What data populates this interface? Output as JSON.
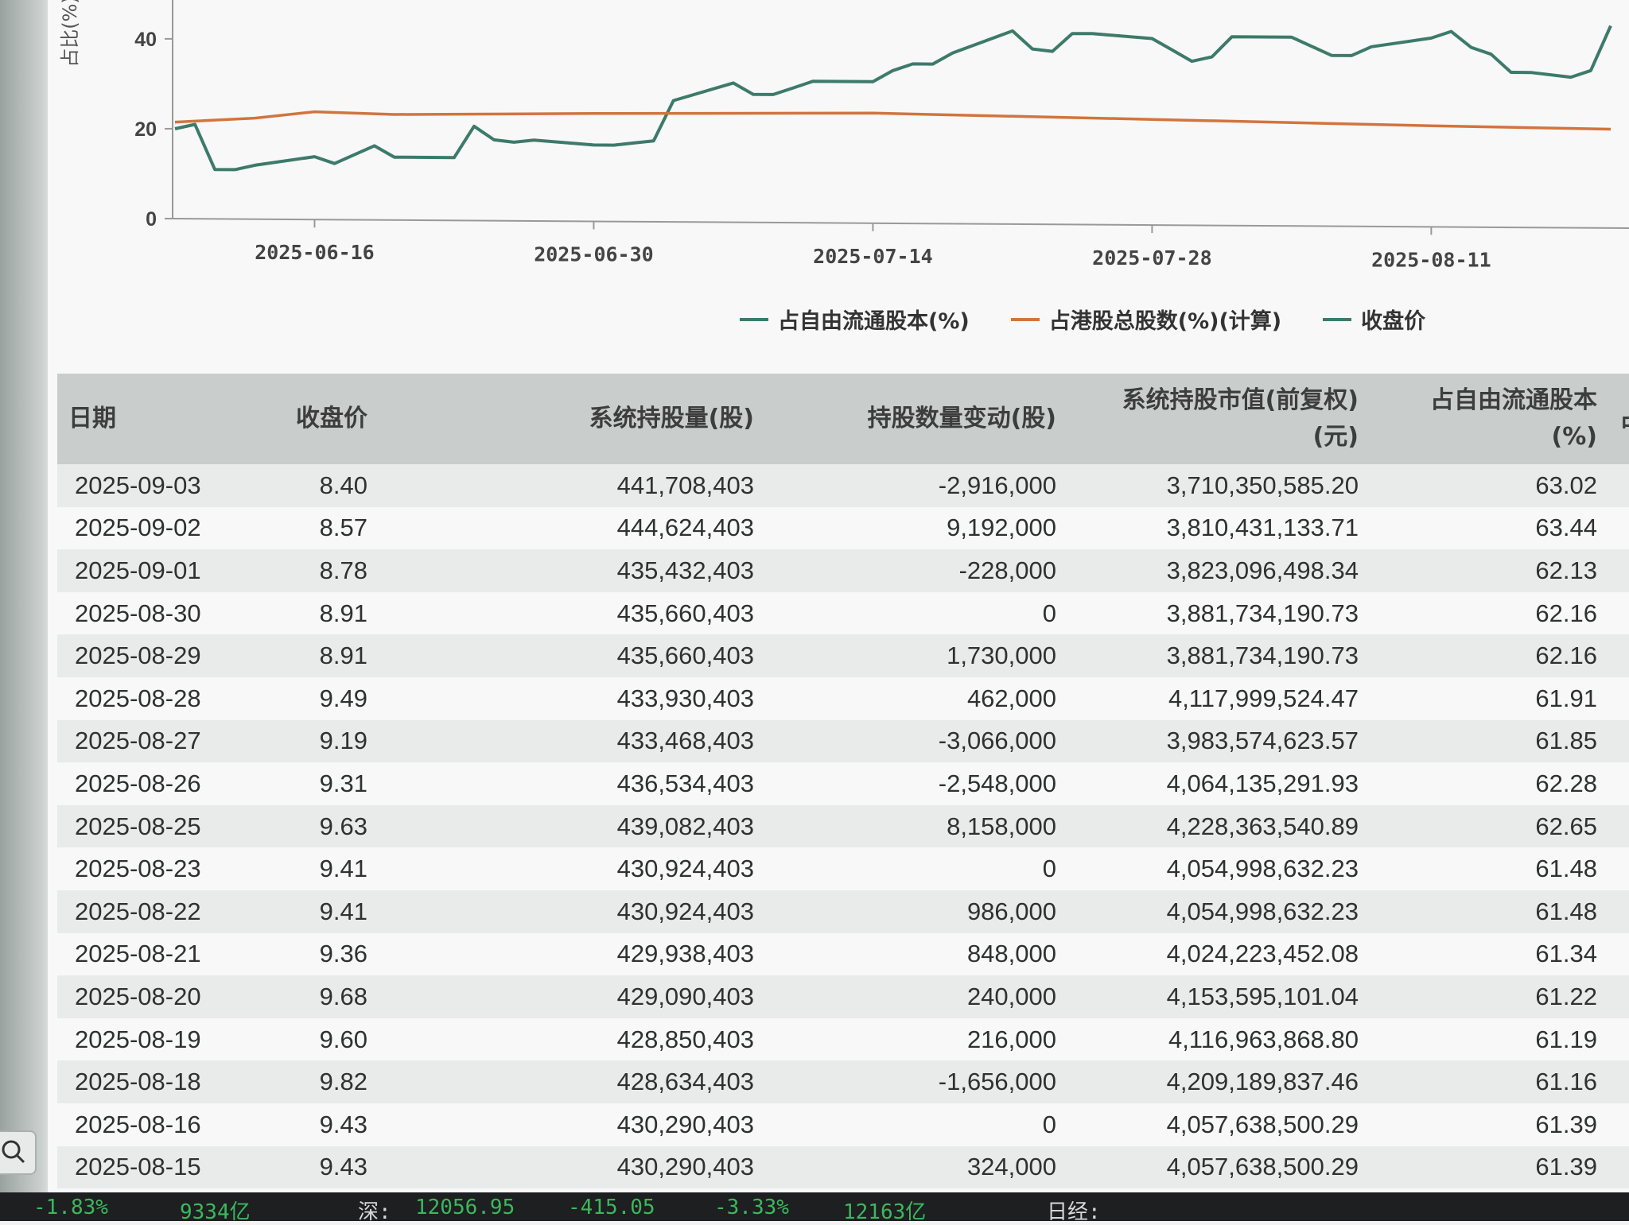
{
  "chart": {
    "y_axis_title": "占比(%)",
    "y_ticks": [
      "0",
      "20",
      "40"
    ],
    "x_ticks": [
      "2025-06-16",
      "2025-06-30",
      "2025-07-14",
      "2025-07-28",
      "2025-08-11"
    ],
    "legend": [
      {
        "label": "占自由流通股本(%)",
        "color": "#3d7a6a"
      },
      {
        "label": "占港股总股数(%)(计算)",
        "color": "#d2743e"
      },
      {
        "label": "收盘价",
        "color": "#3d7a6a"
      }
    ]
  },
  "chart_data": {
    "type": "line",
    "xlabel": "",
    "ylabel": "占比(%)",
    "ylim": [
      0,
      45
    ],
    "x_range": [
      "2025-06-09",
      "2025-08-19"
    ],
    "grid": false,
    "legend_position": "bottom",
    "series": [
      {
        "name": "占自由流通股本(%)",
        "color": "#3d7a6a",
        "points": [
          [
            "2025-06-09",
            20.0
          ],
          [
            "2025-06-10",
            21.0
          ],
          [
            "2025-06-11",
            11.0
          ],
          [
            "2025-06-12",
            11.0
          ],
          [
            "2025-06-13",
            12.0
          ],
          [
            "2025-06-16",
            14.0
          ],
          [
            "2025-06-17",
            12.5
          ],
          [
            "2025-06-18",
            14.5
          ],
          [
            "2025-06-19",
            16.5
          ],
          [
            "2025-06-20",
            14.0
          ],
          [
            "2025-06-23",
            14.0
          ],
          [
            "2025-06-24",
            21.0
          ],
          [
            "2025-06-25",
            18.0
          ],
          [
            "2025-06-26",
            17.5
          ],
          [
            "2025-06-27",
            18.0
          ],
          [
            "2025-06-30",
            17.0
          ],
          [
            "2025-07-01",
            17.0
          ],
          [
            "2025-07-02",
            17.5
          ],
          [
            "2025-07-03",
            18.0
          ],
          [
            "2025-07-04",
            27.0
          ],
          [
            "2025-07-07",
            31.0
          ],
          [
            "2025-07-08",
            28.5
          ],
          [
            "2025-07-09",
            28.5
          ],
          [
            "2025-07-10",
            30.0
          ],
          [
            "2025-07-11",
            31.5
          ],
          [
            "2025-07-14",
            31.5
          ],
          [
            "2025-07-15",
            34.0
          ],
          [
            "2025-07-16",
            35.5
          ],
          [
            "2025-07-17",
            35.5
          ],
          [
            "2025-07-18",
            38.0
          ],
          [
            "2025-07-21",
            43.0
          ],
          [
            "2025-07-22",
            39.0
          ],
          [
            "2025-07-23",
            38.5
          ],
          [
            "2025-07-24",
            42.5
          ],
          [
            "2025-07-25",
            42.5
          ],
          [
            "2025-07-28",
            41.5
          ],
          [
            "2025-07-29",
            39.0
          ],
          [
            "2025-07-30",
            36.5
          ],
          [
            "2025-07-31",
            37.5
          ],
          [
            "2025-08-01",
            42.0
          ],
          [
            "2025-08-04",
            42.0
          ],
          [
            "2025-08-05",
            40.0
          ],
          [
            "2025-08-06",
            38.0
          ],
          [
            "2025-08-07",
            38.0
          ],
          [
            "2025-08-08",
            40.0
          ],
          [
            "2025-08-11",
            42.0
          ],
          [
            "2025-08-12",
            43.5
          ],
          [
            "2025-08-13",
            40.0
          ],
          [
            "2025-08-14",
            38.5
          ],
          [
            "2025-08-15",
            34.5
          ],
          [
            "2025-08-16",
            34.5
          ],
          [
            "2025-08-18",
            33.5
          ],
          [
            "2025-08-19",
            35.0
          ],
          [
            "2025-08-20",
            45.0
          ]
        ]
      },
      {
        "name": "占港股总股数(%)(计算)",
        "color": "#d2743e",
        "points": [
          [
            "2025-06-09",
            21.5
          ],
          [
            "2025-06-13",
            22.5
          ],
          [
            "2025-06-16",
            24.0
          ],
          [
            "2025-06-20",
            23.5
          ],
          [
            "2025-06-30",
            24.0
          ],
          [
            "2025-07-14",
            24.5
          ],
          [
            "2025-07-28",
            23.5
          ],
          [
            "2025-08-11",
            22.5
          ],
          [
            "2025-08-20",
            22.0
          ]
        ]
      }
    ]
  },
  "table": {
    "headers": [
      {
        "line1": "日期",
        "line2": ""
      },
      {
        "line1": "收盘价",
        "line2": ""
      },
      {
        "line1": "系统持股量(股)",
        "line2": ""
      },
      {
        "line1": "持股数量变动(股)",
        "line2": ""
      },
      {
        "line1": "系统持股市值(前复权)",
        "line2": "(元)"
      },
      {
        "line1": "占自由流通股本",
        "line2": "(%)"
      },
      {
        "line1": "占港",
        "line2": ""
      }
    ],
    "rows": [
      [
        "2025-09-03",
        "8.40",
        "441,708,403",
        "-2,916,000",
        "3,710,350,585.20",
        "63.02"
      ],
      [
        "2025-09-02",
        "8.57",
        "444,624,403",
        "9,192,000",
        "3,810,431,133.71",
        "63.44"
      ],
      [
        "2025-09-01",
        "8.78",
        "435,432,403",
        "-228,000",
        "3,823,096,498.34",
        "62.13"
      ],
      [
        "2025-08-30",
        "8.91",
        "435,660,403",
        "0",
        "3,881,734,190.73",
        "62.16"
      ],
      [
        "2025-08-29",
        "8.91",
        "435,660,403",
        "1,730,000",
        "3,881,734,190.73",
        "62.16"
      ],
      [
        "2025-08-28",
        "9.49",
        "433,930,403",
        "462,000",
        "4,117,999,524.47",
        "61.91"
      ],
      [
        "2025-08-27",
        "9.19",
        "433,468,403",
        "-3,066,000",
        "3,983,574,623.57",
        "61.85"
      ],
      [
        "2025-08-26",
        "9.31",
        "436,534,403",
        "-2,548,000",
        "4,064,135,291.93",
        "62.28"
      ],
      [
        "2025-08-25",
        "9.63",
        "439,082,403",
        "8,158,000",
        "4,228,363,540.89",
        "62.65"
      ],
      [
        "2025-08-23",
        "9.41",
        "430,924,403",
        "0",
        "4,054,998,632.23",
        "61.48"
      ],
      [
        "2025-08-22",
        "9.41",
        "430,924,403",
        "986,000",
        "4,054,998,632.23",
        "61.48"
      ],
      [
        "2025-08-21",
        "9.36",
        "429,938,403",
        "848,000",
        "4,024,223,452.08",
        "61.34"
      ],
      [
        "2025-08-20",
        "9.68",
        "429,090,403",
        "240,000",
        "4,153,595,101.04",
        "61.22"
      ],
      [
        "2025-08-19",
        "9.60",
        "428,850,403",
        "216,000",
        "4,116,963,868.80",
        "61.19"
      ],
      [
        "2025-08-18",
        "9.82",
        "428,634,403",
        "-1,656,000",
        "4,209,189,837.46",
        "61.16"
      ],
      [
        "2025-08-16",
        "9.43",
        "430,290,403",
        "0",
        "4,057,638,500.29",
        "61.39"
      ],
      [
        "2025-08-15",
        "9.43",
        "430,290,403",
        "324,000",
        "4,057,638,500.29",
        "61.39"
      ]
    ]
  },
  "status_bar": {
    "items": [
      {
        "text": "-1.83%",
        "color": "#3cb85c"
      },
      {
        "text": "9334亿",
        "color": "#3cb85c"
      },
      {
        "text": "深:",
        "color": "#d8d8d8"
      },
      {
        "text": "12056.95",
        "color": "#3cb85c"
      },
      {
        "text": "-415.05",
        "color": "#3cb85c"
      },
      {
        "text": "-3.33%",
        "color": "#3cb85c"
      },
      {
        "text": "12163亿",
        "color": "#3cb85c"
      },
      {
        "text": "日经:",
        "color": "#d8d8d8"
      }
    ]
  }
}
